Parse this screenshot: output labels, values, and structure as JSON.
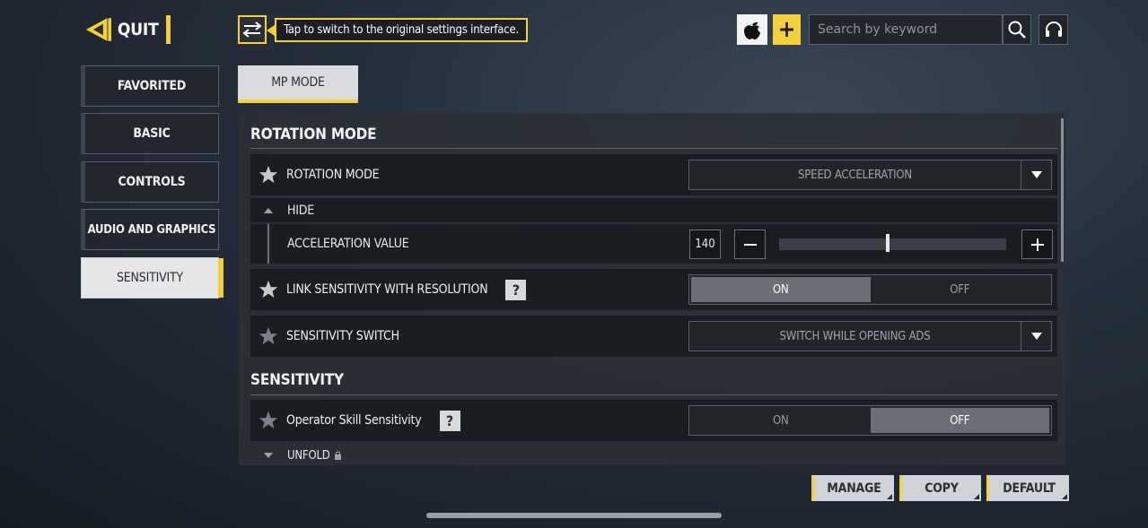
{
  "header": {
    "quit_label": "QUIT",
    "tip_text": "Tap to switch to the original settings interface.",
    "search_placeholder": "Search by keyword"
  },
  "sidebar": {
    "items": [
      {
        "label": "FAVORITED"
      },
      {
        "label": "BASIC"
      },
      {
        "label": "CONTROLS"
      },
      {
        "label": "AUDIO AND GRAPHICS"
      },
      {
        "label": "SENSITIVITY"
      }
    ],
    "active": "SENSITIVITY"
  },
  "mode_tab": "MP MODE",
  "rotation_section": {
    "title": "ROTATION MODE",
    "rotation_mode": {
      "label": "ROTATION MODE",
      "value": "SPEED ACCELERATION"
    },
    "hide_label": "HIDE",
    "acceleration": {
      "label": "ACCELERATION VALUE",
      "value": "140",
      "fraction": 0.47
    },
    "link_sensitivity": {
      "label": "LINK SENSITIVITY WITH RESOLUTION",
      "on": "ON",
      "off": "OFF",
      "selected": "ON"
    },
    "sensitivity_switch": {
      "label": "SENSITIVITY SWITCH",
      "value": "SWITCH WHILE OPENING ADS"
    }
  },
  "sensitivity_section": {
    "title": "SENSITIVITY",
    "operator_skill": {
      "label": "Operator Skill Sensitivity",
      "on": "ON",
      "off": "OFF",
      "selected": "OFF"
    },
    "unfold_label": "UNFOLD"
  },
  "footer": {
    "manage": "MANAGE",
    "copy": "COPY",
    "default": "DEFAULT"
  },
  "colors": {
    "accent": "#f4d13a",
    "panel": "#2c3036"
  }
}
